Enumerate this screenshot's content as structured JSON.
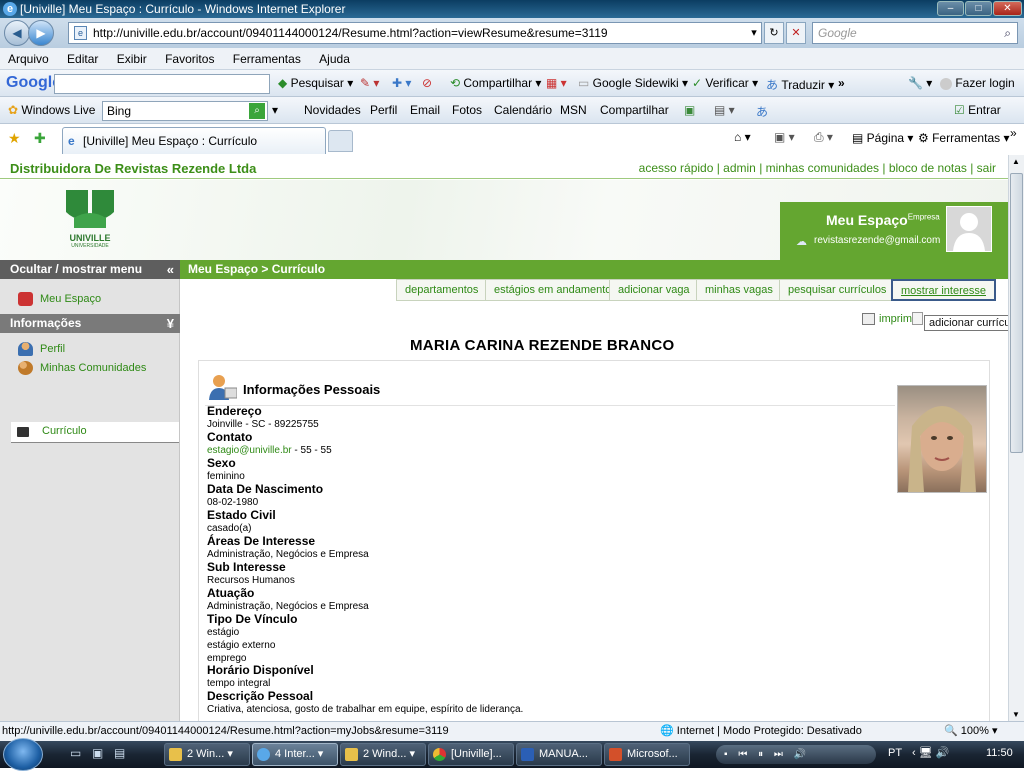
{
  "window": {
    "title": "[Univille] Meu Espaço : Currículo - Windows Internet Explorer"
  },
  "address": {
    "url": "http://univille.edu.br/account/09401144000124/Resume.html?action=viewResume&resume=3119",
    "search_placeholder": "Google"
  },
  "menu": [
    "Arquivo",
    "Editar",
    "Exibir",
    "Favoritos",
    "Ferramentas",
    "Ajuda"
  ],
  "google_toolbar": {
    "logo": "Google",
    "search": "Pesquisar",
    "share": "Compartilhar",
    "sidewiki": "Google Sidewiki",
    "verify": "Verificar",
    "translate": "Traduzir",
    "login": "Fazer login",
    "more": "»"
  },
  "live_toolbar": {
    "brand": "Windows Live",
    "search_value": "Bing",
    "items": [
      "Novidades",
      "Perfil",
      "Email",
      "Fotos",
      "Calendário",
      "MSN",
      "Compartilhar"
    ],
    "signin": "Entrar"
  },
  "tabbar": {
    "tab_title": "[Univille] Meu Espaço : Currículo",
    "page": "Página",
    "tools": "Ferramentas"
  },
  "site": {
    "company": "Distribuidora De Revistas Rezende Ltda",
    "toplinks": "acesso rápido  |  admin  |  minhas comunidades  |  bloco de notas  |  sair",
    "logo_text": "UNIVILLE",
    "logo_sub": "UNIVERSIDADE",
    "me_title": "Meu Espaço",
    "me_sup": "Empresa",
    "me_email": "revistasrezende@gmail.com",
    "breadcrumb": "Meu Espaço >  Currículo"
  },
  "sidebar": {
    "toggle": "Ocultar / mostrar menu",
    "meu_espaco": "Meu Espaço",
    "section": "Informações",
    "items": [
      "Perfil",
      "Minhas Comunidades",
      "Currículo"
    ]
  },
  "nav_buttons": [
    "departamentos",
    "estágios em andamento",
    "adicionar vaga",
    "minhas vagas",
    "pesquisar currículos",
    "mostrar interesse"
  ],
  "print": "imprimir",
  "tooltip": "adicionar currículo",
  "resume": {
    "name": "MARIA CARINA REZENDE BRANCO",
    "section": "Informações Pessoais",
    "fields": [
      {
        "label": "Endereço",
        "values": [
          "Joinville - SC - 89225755"
        ]
      },
      {
        "label": "Contato",
        "link": "estagio@univille.br",
        "values": [
          " - 55 - 55"
        ]
      },
      {
        "label": "Sexo",
        "values": [
          "feminino"
        ]
      },
      {
        "label": "Data De Nascimento",
        "values": [
          "08-02-1980"
        ]
      },
      {
        "label": "Estado Civil",
        "values": [
          "casado(a)"
        ]
      },
      {
        "label": "Áreas De Interesse",
        "values": [
          "Administração, Negócios e Empresa"
        ]
      },
      {
        "label": "Sub Interesse",
        "values": [
          "Recursos Humanos"
        ]
      },
      {
        "label": "Atuação",
        "values": [
          "Administração, Negócios e Empresa"
        ]
      },
      {
        "label": "Tipo De Vínculo",
        "values": [
          "estágio",
          "estágio externo",
          "emprego"
        ]
      },
      {
        "label": "Horário Disponível",
        "values": [
          "tempo integral"
        ]
      },
      {
        "label": "Descrição Pessoal",
        "values": [
          "Criativa, atenciosa, gosto de trabalhar em equipe, espírito de liderança."
        ]
      }
    ]
  },
  "status": {
    "url": "http://univille.edu.br/account/09401144000124/Resume.html?action=myJobs&resume=3119",
    "zone": "Internet | Modo Protegido: Desativado",
    "zoom": "100%"
  },
  "taskbar": {
    "tasks": [
      "2 Win...",
      "4 Inter...",
      "2 Wind...",
      "[Univille]...",
      "MANUA...",
      "Microsof..."
    ],
    "lang": "PT",
    "clock": "11:50"
  },
  "colors": {
    "green": "#64a630",
    "link": "#2f8a16"
  }
}
